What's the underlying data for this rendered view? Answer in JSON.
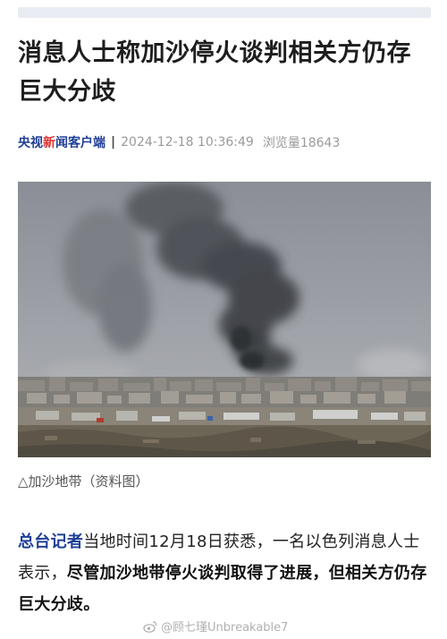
{
  "article": {
    "title": "消息人士称加沙停火谈判相关方仍存巨大分歧",
    "source_main": "央视",
    "source_accent": "新",
    "source_rest": "闻客户端",
    "separator": "|",
    "datetime": "2024-12-18 10:36:49",
    "views": "浏览量18643",
    "caption": "△加沙地带（资料图）",
    "body": {
      "reporter": "总台记者",
      "lead": "当地时间12月18日获悉，一名以色列消息人士表示，",
      "emphasis": "尽管加沙地带停火谈判取得了进展，但相关方仍存巨大分歧。"
    }
  },
  "watermark": {
    "text": "@顾七瑾Unbreakable7",
    "icon": "weibo-logo-icon"
  }
}
